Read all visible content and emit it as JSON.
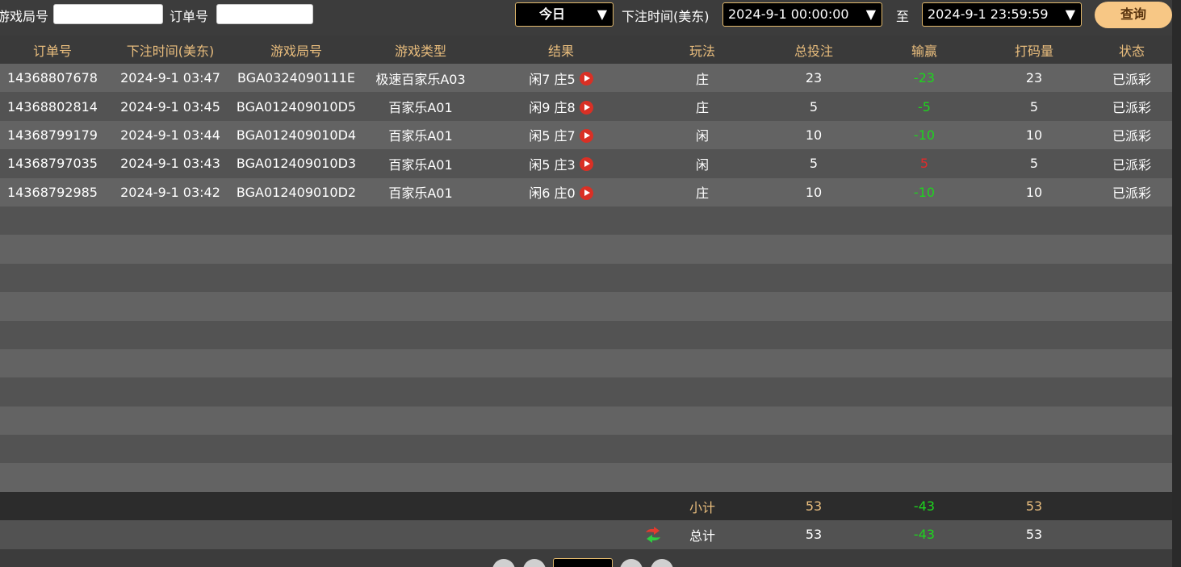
{
  "filters": {
    "game_round_label": "游戏局号",
    "game_round_value": "",
    "order_label": "订单号",
    "order_value": "",
    "date_range_selected": "今日",
    "bet_time_label": "下注时间(美东)",
    "start_time": "2024-9-1 00:00:00",
    "to_label": "至",
    "end_time": "2024-9-1 23:59:59",
    "query_label": "查询"
  },
  "table": {
    "columns": [
      "订单号",
      "下注时间(美东)",
      "游戏局号",
      "游戏类型",
      "结果",
      "玩法",
      "总投注",
      "输赢",
      "打码量",
      "状态"
    ],
    "rows": [
      {
        "order": "14368807678",
        "time": "2024-9-1 03:47",
        "round": "BGA0324090111E",
        "type": "极速百家乐A03",
        "result": "闲7 庄5",
        "play": "庄",
        "bet": "23",
        "winloss": "-23",
        "winloss_sign": "neg",
        "turnover": "23",
        "status": "已派彩"
      },
      {
        "order": "14368802814",
        "time": "2024-9-1 03:45",
        "round": "BGA012409010D5",
        "type": "百家乐A01",
        "result": "闲9 庄8",
        "play": "庄",
        "bet": "5",
        "winloss": "-5",
        "winloss_sign": "neg",
        "turnover": "5",
        "status": "已派彩"
      },
      {
        "order": "14368799179",
        "time": "2024-9-1 03:44",
        "round": "BGA012409010D4",
        "type": "百家乐A01",
        "result": "闲5 庄7",
        "play": "闲",
        "bet": "10",
        "winloss": "-10",
        "winloss_sign": "neg",
        "turnover": "10",
        "status": "已派彩"
      },
      {
        "order": "14368797035",
        "time": "2024-9-1 03:43",
        "round": "BGA012409010D3",
        "type": "百家乐A01",
        "result": "闲5 庄3",
        "play": "闲",
        "bet": "5",
        "winloss": "5",
        "winloss_sign": "pos",
        "turnover": "5",
        "status": "已派彩"
      },
      {
        "order": "14368792985",
        "time": "2024-9-1 03:42",
        "round": "BGA012409010D2",
        "type": "百家乐A01",
        "result": "闲6 庄0",
        "play": "庄",
        "bet": "10",
        "winloss": "-10",
        "winloss_sign": "neg",
        "turnover": "10",
        "status": "已派彩"
      }
    ],
    "subtotal": {
      "label": "小计",
      "bet": "53",
      "winloss": "-43",
      "turnover": "53"
    },
    "total": {
      "label": "总计",
      "bet": "53",
      "winloss": "-43",
      "turnover": "53"
    }
  },
  "colors": {
    "accent": "#e9bd7d",
    "negative": "#1ed41e",
    "positive": "#e22a2a",
    "query_button": "#f7c785"
  }
}
